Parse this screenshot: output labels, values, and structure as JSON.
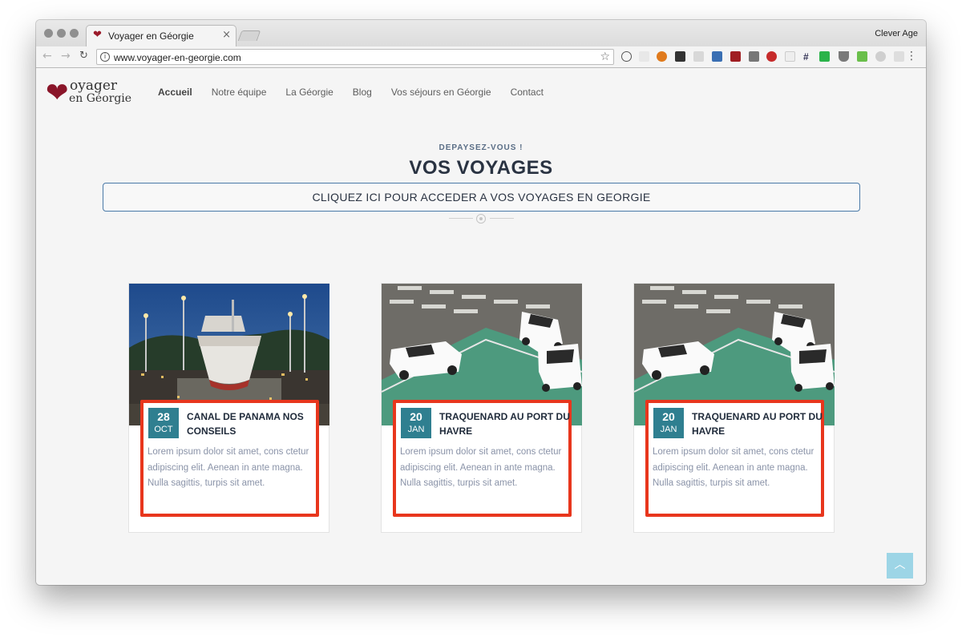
{
  "browser": {
    "tab_title": "Voyager en Géorgie",
    "tab_close": "×",
    "profile_name": "Clever Age",
    "url": "www.voyager-en-georgie.com",
    "back_icon": "←",
    "forward_icon": "→",
    "reload_icon": "C",
    "star_icon": "☆",
    "menu_icon": "⋮",
    "info_icon": "i"
  },
  "site": {
    "logo": {
      "heart": "❤",
      "line1": "oyager",
      "line2": "en Géorgie"
    },
    "nav": [
      "Accueil",
      "Notre équipe",
      "La Géorgie",
      "Blog",
      "Vos séjours en Géorgie",
      "Contact"
    ]
  },
  "section": {
    "kicker": "DEPAYSEZ-VOUS !",
    "title": "VOS VOYAGES",
    "cta": "CLIQUEZ ICI POUR ACCEDER A VOS VOYAGES EN GEORGIE"
  },
  "cards": [
    {
      "day": "28",
      "month": "OCT",
      "title": "CANAL DE PANAMA NOS CONSEILS",
      "text": "Lorem ipsum dolor sit amet, cons ctetur adipiscing elit. Aenean in ante magna. Nulla sagittis, turpis sit amet.",
      "image": "ship-in-canal-lock"
    },
    {
      "day": "20",
      "month": "JAN",
      "title": "TRAQUENARD AU PORT DU HAVRE",
      "text": "Lorem ipsum dolor sit amet, cons ctetur adipiscing elit. Aenean in ante magna. Nulla sagittis, turpis sit amet.",
      "image": "white-vans-on-parking"
    },
    {
      "day": "20",
      "month": "JAN",
      "title": "TRAQUENARD AU PORT DU HAVRE",
      "text": "Lorem ipsum dolor sit amet, cons ctetur adipiscing elit. Aenean in ante magna. Nulla sagittis, turpis sit amet.",
      "image": "white-vans-on-parking"
    }
  ],
  "scroll_top_icon": "︿",
  "colors": {
    "badge": "#2f7f90",
    "highlight_border": "#e8361d",
    "brand_heart": "#8a1529",
    "cta_border": "#4a7aa8"
  }
}
